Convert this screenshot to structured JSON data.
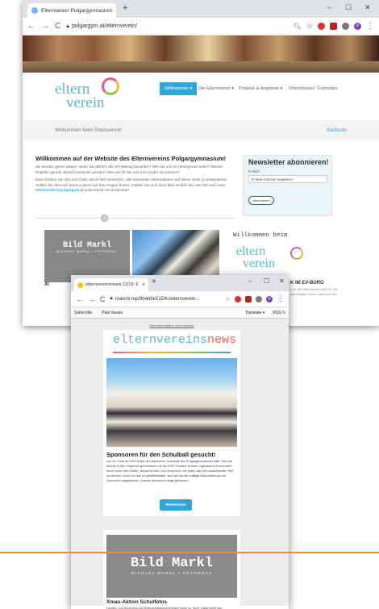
{
  "back_browser": {
    "tab_title": "Elternverein Polgargymnasium",
    "url": "polgargym.at/elternverein/",
    "new_tab": "+",
    "tab_close": "×",
    "window_min": "–",
    "window_max": "☐",
    "window_close": "✕",
    "profile_initial": "V"
  },
  "site": {
    "logo_line1": "eltern",
    "logo_line2": "verein",
    "nav": [
      "Willkommen ▾",
      "Der Elternverein ▾",
      "Projekte & Angebote ▾",
      "Unterstützen!",
      "Formulare"
    ],
    "welcome_bar_left": "Willkommen beim Elternverein!",
    "welcome_bar_right": "Startseite",
    "welcome_title": "Willkommen auf der Website des Elternvereins Polgargymnasium!",
    "welcome_text1": "Sie würden gerne wissen, wofür Sie jährlich den EV-Beitrag bezahlen? Wer bei uns im Hintergrund werkt? Welche Projekte gerade aktuell bearbeitet werden? Was wir für Sie und Ihre Kinder tun können?",
    "welcome_text2": "Dann klicken Sie sich doch bitte durch! Wir versuchen, alle relevanten Informationen auf dieser Seite zu präsentieren. Sollten Sie dennoch keine Antwort auf Ihre Fragen finden, melden Sie sich doch bitte einfach bei uns! Wir sind unter",
    "welcome_email": "elternverein@polgargym.at",
    "welcome_text3": "jederzeit für Sie erreichbar!",
    "newsletter_title": "Newsletter abonnieren!",
    "newsletter_email_label": "E-Mail:",
    "newsletter_placeholder": "E-Mail-Adresse eingeben!",
    "newsletter_button": "Abonnieren!",
    "bildmarkl": "Bild Markl",
    "bildmarkl_sub": "MICHAEL MARKL • FOTOGRAF",
    "willkommen_beim": "Willkommen beim",
    "ev_buero": "K IM EV-BÜRO",
    "ev_buero_text": "n ist der Elternverein nlich für Sie alle Anlagen das in etwa um uns",
    "card_label": "XI"
  },
  "front_browser": {
    "tab_title": "elternvereinsnews 12/19: F",
    "url": "mailchi.mp/9b4d9e5154c/elternverein...",
    "new_tab": "+",
    "tab_close": "×",
    "window_min": "–",
    "window_max": "☐",
    "window_close": "✕",
    "profile_initial": "V",
    "bookmarks": [
      "Subscribe",
      "Past Issues"
    ],
    "translate": "Translate ▾",
    "rss": "RSS ℕ"
  },
  "newsletter": {
    "view_link": "View this email in your browser",
    "logo_part1": "elternvereins",
    "logo_part2": "news",
    "article1_title": "Sponsoren für den Schulball gesucht!",
    "article1_text": "Am 15. Februar 2020 findet der alljährliche Schulball des Polgargymnasiums statt. Das wie bereits in den Vorjahren gemeinsam mit der AHS Theodor Kramer organisierte Event steht heuer unter dem Motto „Welcome Mix“ und verspricht, wie jedes Jahr ein rauschendes Fest zu werden. Doch um das so gewährleisten, sind wir auf die kräftige Unterstützung von Sponsoren angewiesen. Dazzle sind auch einige gebühren...",
    "read_more": "Weiterlesen",
    "ad_label": "Bild Markl",
    "ad_sub": "MICHAEL MARKL • FOTOGRAF",
    "article2_title": "Xmas-Aktion Schulfotos",
    "article2_text": "Familien- und Kinderfotos als Weihnachtsgeschenk liegen immer im Trend. Daher bietet das Fotostudio"
  },
  "colors": {
    "accent": "#2ea8d8",
    "logo_teal": "#5bb9c7",
    "orange_line": "#f28a2e"
  }
}
